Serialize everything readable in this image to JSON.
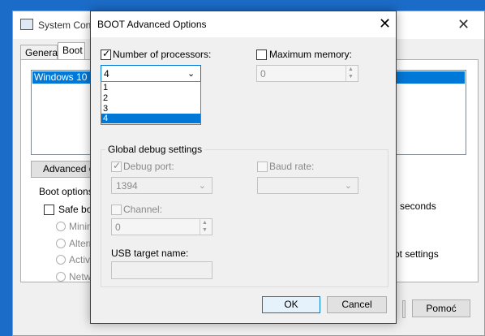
{
  "background_window": {
    "title": "System Conf",
    "close_glyph": "✕",
    "tabs": [
      "General",
      "Boot"
    ],
    "os_entry": "Windows 10 (C",
    "advanced_button": "Advanced op",
    "boot_options_label": "Boot options",
    "safe_boot_label": "Safe boo",
    "radio_labels": [
      "Minima",
      "Altern",
      "Active",
      "Netwo"
    ],
    "seconds_text": "seconds",
    "boot_settings_text": "ot settings",
    "help_button": "Pomoć"
  },
  "dialog": {
    "title": "BOOT Advanced Options",
    "close_glyph": "✕",
    "num_processors_label": "Number of processors:",
    "num_processors_checked": true,
    "num_processors_value": "4",
    "processor_options": [
      "1",
      "2",
      "3",
      "4"
    ],
    "processor_selected": "4",
    "max_memory_label": "Maximum memory:",
    "max_memory_checked": false,
    "max_memory_value": "0",
    "debug_group_label": "Global debug settings",
    "debug_port_label": "Debug port:",
    "debug_port_checked": true,
    "debug_port_value": "1394",
    "baud_rate_label": "Baud rate:",
    "baud_rate_value": "",
    "channel_label": "Channel:",
    "channel_value": "0",
    "usb_target_label": "USB target name:",
    "usb_target_value": "",
    "ok_label": "OK",
    "cancel_label": "Cancel"
  },
  "colors": {
    "desktop": "#1b6cc9",
    "selection": "#0078d7",
    "dialog_bg": "#f0f0f0"
  }
}
